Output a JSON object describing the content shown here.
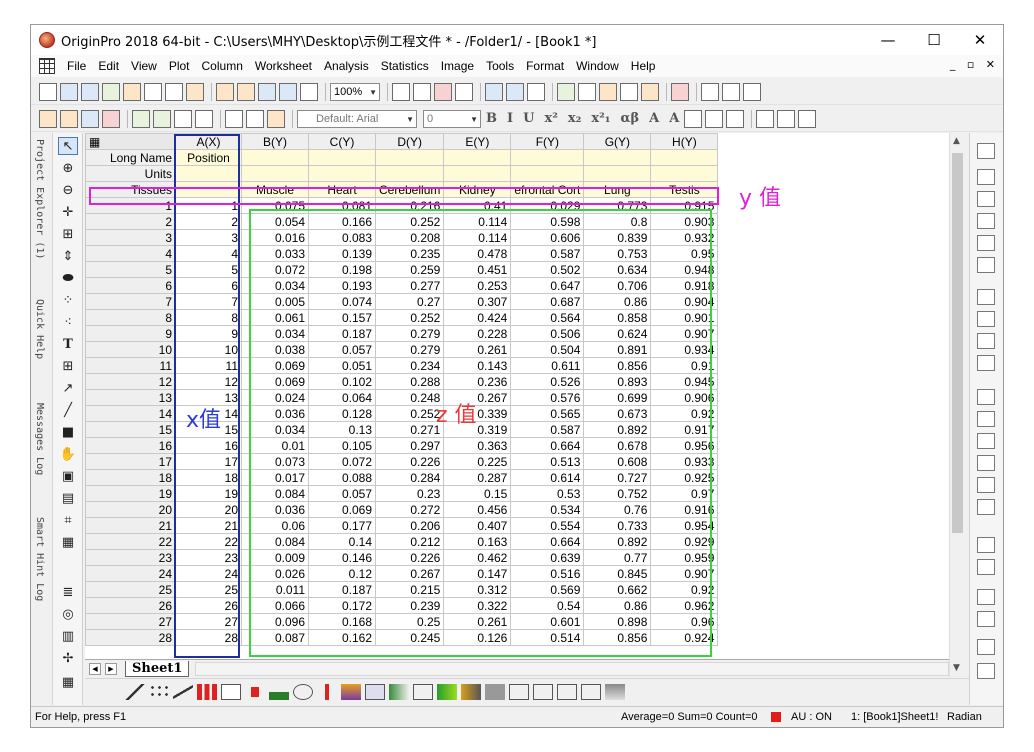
{
  "window": {
    "title": "OriginPro 2018 64-bit - C:\\Users\\MHY\\Desktop\\示例工程文件 * - /Folder1/ - [Book1 *]",
    "minimize_glyph": "—",
    "maximize_glyph": "☐",
    "close_glyph": "✕"
  },
  "menu": {
    "items": [
      "File",
      "Edit",
      "View",
      "Plot",
      "Column",
      "Worksheet",
      "Analysis",
      "Statistics",
      "Image",
      "Tools",
      "Format",
      "Window",
      "Help"
    ],
    "mdi_controls": "_ ▫ ✕"
  },
  "toolbar": {
    "zoom": "100%",
    "font_name": "Default: Arial",
    "font_size": "0",
    "format_buttons": [
      "B",
      "I",
      "U",
      "x²",
      "x₂",
      "x²₁",
      "αβ",
      "A",
      "A"
    ]
  },
  "side_panels": [
    "Project Explorer (1)",
    "Quick Help",
    "Messages Log",
    "Smart Hint Log"
  ],
  "worksheet": {
    "columns": [
      "A(X)",
      "B(Y)",
      "C(Y)",
      "D(Y)",
      "E(Y)",
      "F(Y)",
      "G(Y)",
      "H(Y)"
    ],
    "meta_rows": [
      {
        "label": "Long Name",
        "values": [
          "Position",
          "",
          "",
          "",
          "",
          "",
          "",
          ""
        ]
      },
      {
        "label": "Units",
        "values": [
          "",
          "",
          "",
          "",
          "",
          "",
          "",
          ""
        ]
      },
      {
        "label": "Tissues",
        "values": [
          "",
          "Muscle",
          "Heart",
          "Cerebellum",
          "Kidney",
          "efrontal Cort",
          "Lung",
          "Testis"
        ]
      }
    ],
    "rows": [
      [
        "1",
        "1",
        "0.075",
        "0.081",
        "0.216",
        "0.41",
        "0.029",
        "0.773",
        "0.915"
      ],
      [
        "2",
        "2",
        "0.054",
        "0.166",
        "0.252",
        "0.114",
        "0.598",
        "0.8",
        "0.903"
      ],
      [
        "3",
        "3",
        "0.016",
        "0.083",
        "0.208",
        "0.114",
        "0.606",
        "0.839",
        "0.932"
      ],
      [
        "4",
        "4",
        "0.033",
        "0.139",
        "0.235",
        "0.478",
        "0.587",
        "0.753",
        "0.95"
      ],
      [
        "5",
        "5",
        "0.072",
        "0.198",
        "0.259",
        "0.451",
        "0.502",
        "0.634",
        "0.948"
      ],
      [
        "6",
        "6",
        "0.034",
        "0.193",
        "0.277",
        "0.253",
        "0.647",
        "0.706",
        "0.918"
      ],
      [
        "7",
        "7",
        "0.005",
        "0.074",
        "0.27",
        "0.307",
        "0.687",
        "0.86",
        "0.904"
      ],
      [
        "8",
        "8",
        "0.061",
        "0.157",
        "0.252",
        "0.424",
        "0.564",
        "0.858",
        "0.901"
      ],
      [
        "9",
        "9",
        "0.034",
        "0.187",
        "0.279",
        "0.228",
        "0.506",
        "0.624",
        "0.907"
      ],
      [
        "10",
        "10",
        "0.038",
        "0.057",
        "0.279",
        "0.261",
        "0.504",
        "0.891",
        "0.934"
      ],
      [
        "11",
        "11",
        "0.069",
        "0.051",
        "0.234",
        "0.143",
        "0.611",
        "0.856",
        "0.91"
      ],
      [
        "12",
        "12",
        "0.069",
        "0.102",
        "0.288",
        "0.236",
        "0.526",
        "0.893",
        "0.945"
      ],
      [
        "13",
        "13",
        "0.024",
        "0.064",
        "0.248",
        "0.267",
        "0.576",
        "0.699",
        "0.906"
      ],
      [
        "14",
        "14",
        "0.036",
        "0.128",
        "0.252",
        "0.339",
        "0.565",
        "0.673",
        "0.92"
      ],
      [
        "15",
        "15",
        "0.034",
        "0.13",
        "0.271",
        "0.319",
        "0.587",
        "0.892",
        "0.917"
      ],
      [
        "16",
        "16",
        "0.01",
        "0.105",
        "0.297",
        "0.363",
        "0.664",
        "0.678",
        "0.956"
      ],
      [
        "17",
        "17",
        "0.073",
        "0.072",
        "0.226",
        "0.225",
        "0.513",
        "0.608",
        "0.933"
      ],
      [
        "18",
        "18",
        "0.017",
        "0.088",
        "0.284",
        "0.287",
        "0.614",
        "0.727",
        "0.925"
      ],
      [
        "19",
        "19",
        "0.084",
        "0.057",
        "0.23",
        "0.15",
        "0.53",
        "0.752",
        "0.97"
      ],
      [
        "20",
        "20",
        "0.036",
        "0.069",
        "0.272",
        "0.456",
        "0.534",
        "0.76",
        "0.916"
      ],
      [
        "21",
        "21",
        "0.06",
        "0.177",
        "0.206",
        "0.407",
        "0.554",
        "0.733",
        "0.954"
      ],
      [
        "22",
        "22",
        "0.084",
        "0.14",
        "0.212",
        "0.163",
        "0.664",
        "0.892",
        "0.929"
      ],
      [
        "23",
        "23",
        "0.009",
        "0.146",
        "0.226",
        "0.462",
        "0.639",
        "0.77",
        "0.959"
      ],
      [
        "24",
        "24",
        "0.026",
        "0.12",
        "0.267",
        "0.147",
        "0.516",
        "0.845",
        "0.907"
      ],
      [
        "25",
        "25",
        "0.011",
        "0.187",
        "0.215",
        "0.312",
        "0.569",
        "0.662",
        "0.92"
      ],
      [
        "26",
        "26",
        "0.066",
        "0.172",
        "0.239",
        "0.322",
        "0.54",
        "0.86",
        "0.962"
      ],
      [
        "27",
        "27",
        "0.096",
        "0.168",
        "0.25",
        "0.261",
        "0.601",
        "0.898",
        "0.96"
      ],
      [
        "28",
        "28",
        "0.087",
        "0.162",
        "0.245",
        "0.126",
        "0.514",
        "0.856",
        "0.924"
      ]
    ]
  },
  "sheet_tab": "Sheet1",
  "annotations": {
    "x_label": "x值",
    "y_label": "y 值",
    "z_label": "z 值",
    "x_color": "#1c2f9e",
    "y_color": "#e020d4",
    "z_color": "#3ad43a"
  },
  "status": {
    "help": "For Help, press F1",
    "stats": "Average=0 Sum=0 Count=0",
    "au": "AU : ON",
    "cell": "1: [Book1]Sheet1!",
    "angle": "Radian"
  }
}
